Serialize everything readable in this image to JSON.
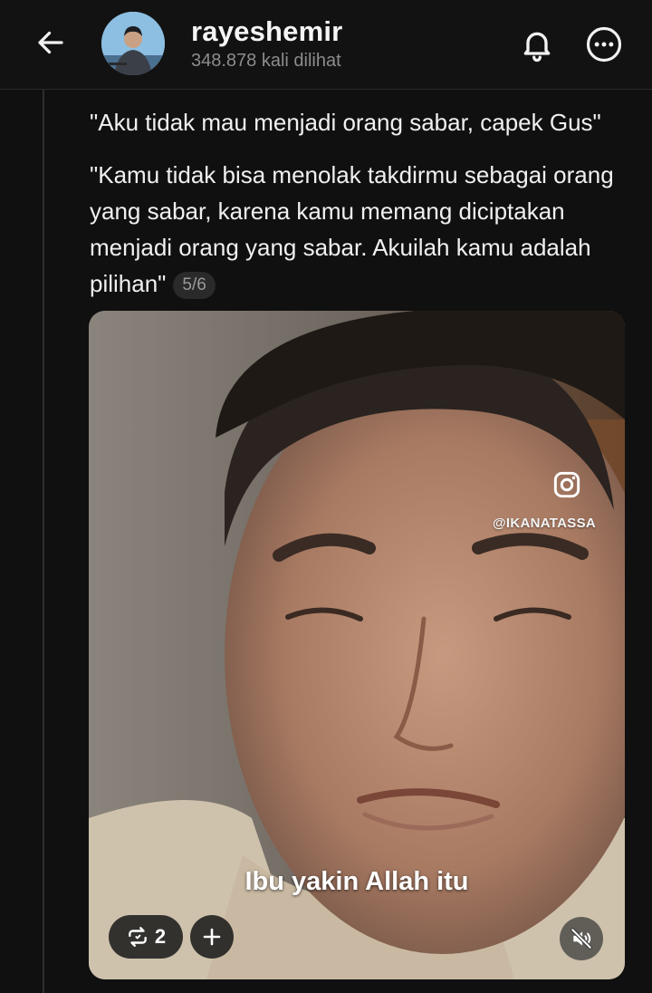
{
  "header": {
    "username": "rayeshemir",
    "views": "348.878 kali dilihat"
  },
  "post": {
    "text_line1": "\"Aku tidak mau menjadi orang sabar, capek Gus\"",
    "text_line2": "\"Kamu tidak bisa menolak takdirmu sebagai orang yang sabar, karena kamu memang diciptakan menjadi orang yang sabar. Akuilah kamu adalah pilihan\"",
    "counter": "5/6"
  },
  "video": {
    "watermark_handle": "@IKANATASSA",
    "subtitle": "Ibu yakin Allah itu",
    "repost_count": "2"
  },
  "icons": {
    "back": "arrow-left-icon",
    "notifications": "bell-icon",
    "more": "more-options-icon",
    "instagram": "instagram-icon",
    "repost": "repost-icon",
    "add": "plus-icon",
    "mute": "muted-speaker-icon"
  },
  "colors": {
    "background": "#101010",
    "text": "#f0f0f0",
    "muted_text": "#8c8c8c"
  }
}
